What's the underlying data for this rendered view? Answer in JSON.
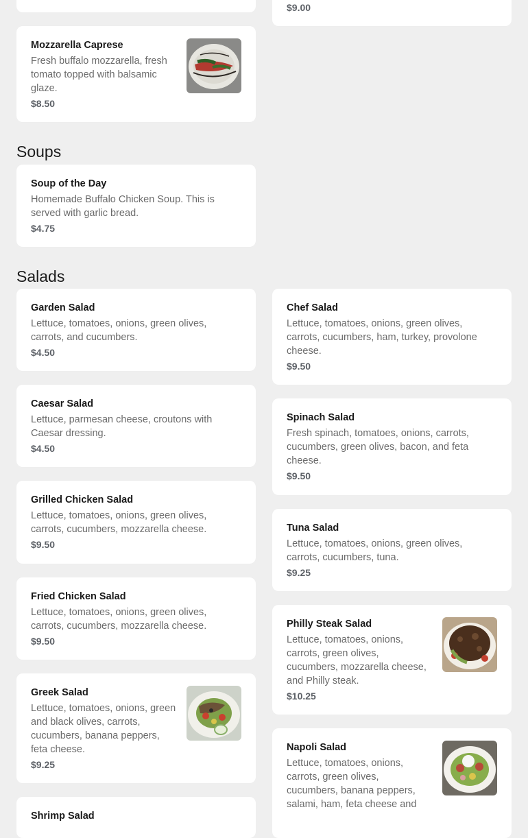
{
  "partial_top": {
    "right_price": "$9.00"
  },
  "appetizers": {
    "mozzarella_caprese": {
      "name": "Mozzarella Caprese",
      "description": "Fresh buffalo mozzarella, fresh tomato topped with balsamic glaze.",
      "price": "$8.50"
    }
  },
  "soups": {
    "title": "Soups",
    "items": [
      {
        "name": "Soup of the Day",
        "description": "Homemade Buffalo Chicken Soup. This is served with garlic bread.",
        "price": "$4.75"
      }
    ]
  },
  "salads": {
    "title": "Salads",
    "left": [
      {
        "name": "Garden Salad",
        "description": "Lettuce, tomatoes, onions, green olives, carrots, and cucumbers.",
        "price": "$4.50"
      },
      {
        "name": "Caesar Salad",
        "description": "Lettuce, parmesan cheese, croutons with Caesar dressing.",
        "price": "$4.50"
      },
      {
        "name": "Grilled Chicken Salad",
        "description": "Lettuce, tomatoes, onions, green olives, carrots, cucumbers, mozzarella cheese.",
        "price": "$9.50"
      },
      {
        "name": "Fried Chicken Salad",
        "description": "Lettuce, tomatoes, onions, green olives, carrots, cucumbers, mozzarella cheese.",
        "price": "$9.50"
      },
      {
        "name": "Greek Salad",
        "description": "Lettuce, tomatoes, onions, green and black olives, carrots, cucumbers, banana peppers, feta cheese.",
        "price": "$9.25"
      },
      {
        "name": "Shrimp Salad"
      }
    ],
    "right": [
      {
        "name": "Chef Salad",
        "description": "Lettuce, tomatoes, onions, green olives, carrots, cucumbers, ham, turkey, provolone cheese.",
        "price": "$9.50"
      },
      {
        "name": "Spinach Salad",
        "description": "Fresh spinach, tomatoes, onions, carrots, cucumbers, green olives, bacon, and feta cheese.",
        "price": "$9.50"
      },
      {
        "name": "Tuna Salad",
        "description": "Lettuce, tomatoes, onions, green olives, carrots, cucumbers, tuna.",
        "price": "$9.25"
      },
      {
        "name": "Philly Steak Salad",
        "description": "Lettuce, tomatoes, onions, carrots, green olives, cucumbers, mozzarella cheese, and Philly steak.",
        "price": "$10.25"
      },
      {
        "name": "Napoli Salad",
        "description": "Lettuce, tomatoes, onions, carrots, green olives, cucumbers, banana peppers, salami, ham, feta cheese and"
      }
    ]
  },
  "colors": {
    "background": "#efefef",
    "card": "#ffffff",
    "title_text": "#1a1a1a",
    "description_text": "#6b6b6b",
    "price_text": "#5d6167"
  }
}
